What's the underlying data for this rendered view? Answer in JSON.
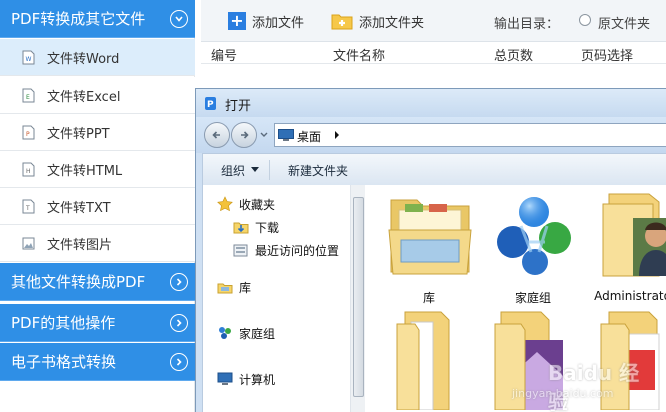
{
  "sidebar": {
    "groups": [
      {
        "title": "PDF转换成其它文件",
        "expanded": true
      },
      {
        "title": "其他文件转换成PDF",
        "expanded": false
      },
      {
        "title": "PDF的其他操作",
        "expanded": false
      },
      {
        "title": "电子书格式转换",
        "expanded": false
      }
    ],
    "items": [
      {
        "label": "文件转Word",
        "icon": "word-doc-icon",
        "active": true
      },
      {
        "label": "文件转Excel",
        "icon": "excel-doc-icon",
        "active": false
      },
      {
        "label": "文件转PPT",
        "icon": "ppt-doc-icon",
        "active": false
      },
      {
        "label": "文件转HTML",
        "icon": "html-doc-icon",
        "active": false
      },
      {
        "label": "文件转TXT",
        "icon": "txt-doc-icon",
        "active": false
      },
      {
        "label": "文件转图片",
        "icon": "image-doc-icon",
        "active": false
      }
    ]
  },
  "toolbar": {
    "add_file": "添加文件",
    "add_folder": "添加文件夹",
    "output_label": "输出目录：",
    "output_option": "原文件夹"
  },
  "table": {
    "columns": [
      "编号",
      "文件名称",
      "总页数",
      "页码选择"
    ]
  },
  "dialog": {
    "title": "打开",
    "address": "桌面",
    "organize": "组织",
    "new_folder": "新建文件夹",
    "nav": {
      "favorites": "收藏夹",
      "downloads": "下载",
      "recent": "最近访问的位置",
      "libraries": "库",
      "homegroup": "家庭组",
      "computer": "计算机"
    },
    "files": [
      {
        "name": "库",
        "icon": "library-folder-icon"
      },
      {
        "name": "家庭组",
        "icon": "homegroup-icon"
      },
      {
        "name": "Administrator",
        "icon": "user-folder-icon"
      }
    ]
  },
  "watermark": {
    "text": "Baidu 经验",
    "url": "jingyan.baidu.com"
  },
  "colors": {
    "sidebar_header": "#2f8fe6",
    "sidebar_active": "#dcedfb",
    "dialog_frame": "#cfe0f3"
  }
}
